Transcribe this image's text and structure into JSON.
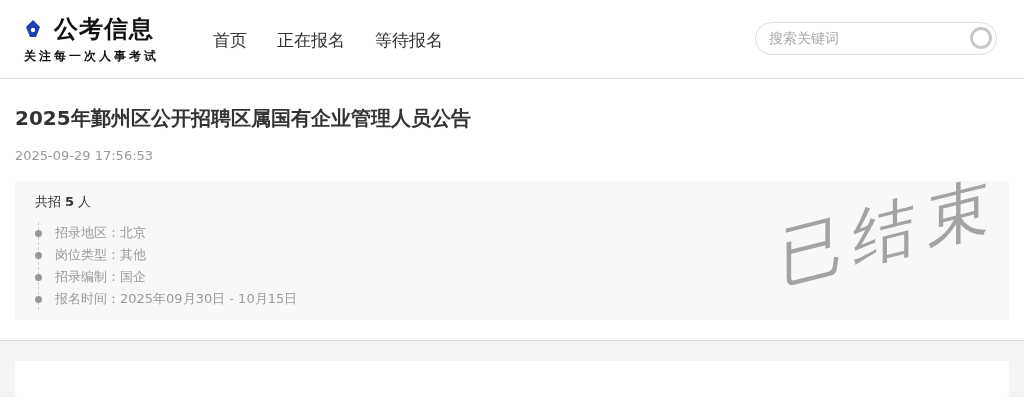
{
  "header": {
    "logo": {
      "name": "公考信息",
      "tagline": "关注每一次人事考试"
    },
    "nav": [
      {
        "label": "首页"
      },
      {
        "label": "正在报名"
      },
      {
        "label": "等待报名"
      }
    ],
    "search": {
      "placeholder": "搜索关键词"
    }
  },
  "notice": {
    "title": "2025年鄞州区公开招聘区属国有企业管理人员公告",
    "date": "2025-09-29 17:56:53",
    "summary": {
      "prefix": "共招",
      "count": "5",
      "suffix": "人"
    },
    "details": [
      {
        "label": "招录地区：",
        "value": "北京"
      },
      {
        "label": "岗位类型：",
        "value": "其他"
      },
      {
        "label": "招录编制：",
        "value": "国企"
      },
      {
        "label": "报名时间：",
        "value": "2025年09月30日 - 10月15日"
      }
    ],
    "stamp": "已结束"
  }
}
